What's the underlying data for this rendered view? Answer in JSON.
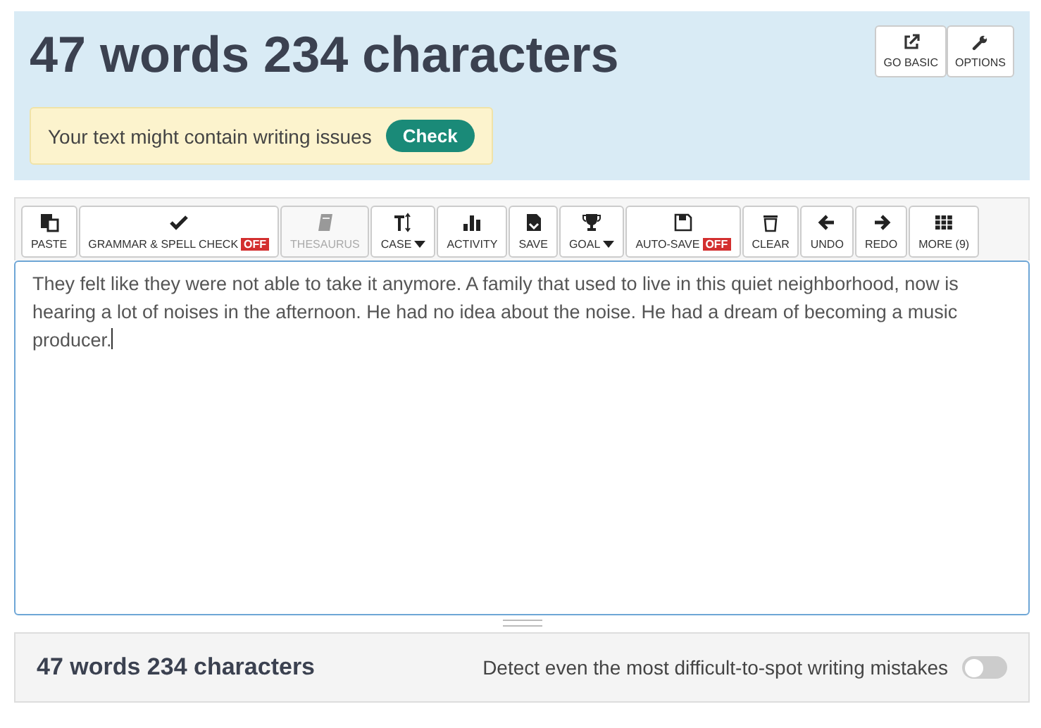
{
  "header": {
    "title": "47 words 234 characters",
    "buttons": [
      {
        "label": "GO BASIC"
      },
      {
        "label": "OPTIONS"
      }
    ]
  },
  "alert": {
    "text": "Your text might contain writing issues",
    "button": "Check"
  },
  "toolbar": [
    {
      "label": "PASTE",
      "disabled": false
    },
    {
      "label": "GRAMMAR & SPELL CHECK",
      "badge": "OFF",
      "disabled": false
    },
    {
      "label": "THESAURUS",
      "disabled": true
    },
    {
      "label": "CASE",
      "dropdown": true,
      "disabled": false
    },
    {
      "label": "ACTIVITY",
      "disabled": false
    },
    {
      "label": "SAVE",
      "disabled": false
    },
    {
      "label": "GOAL",
      "dropdown": true,
      "disabled": false
    },
    {
      "label": "AUTO-SAVE",
      "badge": "OFF",
      "disabled": false
    },
    {
      "label": "CLEAR",
      "disabled": false
    },
    {
      "label": "UNDO",
      "disabled": false
    },
    {
      "label": "REDO",
      "disabled": false
    },
    {
      "label": "MORE (9)",
      "disabled": false
    }
  ],
  "editor": {
    "value": "They felt like they were not able to take it anymore. A family that used to live in this quiet neighborhood, now is hearing a lot of noises in the afternoon. He had no idea about the noise. He had a dream of becoming a music producer."
  },
  "footer": {
    "count": "47 words 234 characters",
    "promo": "Detect even the most difficult-to-spot writing mistakes",
    "toggle_on": false
  }
}
